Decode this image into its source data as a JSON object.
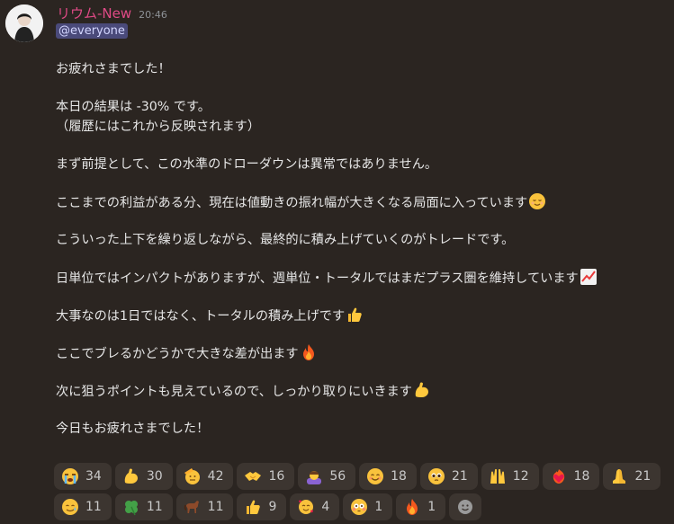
{
  "message": {
    "username": "リウム-New",
    "timestamp": "20:46",
    "mention": "@everyone",
    "lines": [
      "お疲れさまでした！",
      "本日の結果は -30% です。",
      "（履歴にはこれから反映されます）",
      "まず前提として、この水準のドローダウンは異常ではありません。",
      "ここまでの利益がある分、現在は値動きの振れ幅が大きくなる局面に入っています",
      "こういった上下を繰り返しながら、最終的に積み上げていくのがトレードです。",
      "日単位ではインパクトがありますが、週単位・トータルではまだプラス圏を維持しています",
      "大事なのは1日ではなく、トータルの積み上げです",
      "ここでブレるかどうかで大きな差が出ます",
      "次に狙うポイントも見えているので、しっかり取りにいきます",
      "今日もお疲れさまでした！"
    ],
    "line_emojis": [
      "relieved-face",
      "chart-increasing",
      "thumbs-up",
      "fire",
      "flexed-biceps"
    ]
  },
  "reactions": [
    {
      "icon": "loudly-crying-face",
      "count": "34"
    },
    {
      "icon": "flexed-biceps",
      "count": "30"
    },
    {
      "icon": "saluting-face",
      "count": "42"
    },
    {
      "icon": "handshake",
      "count": "16"
    },
    {
      "icon": "person-bowing",
      "count": "56"
    },
    {
      "icon": "smiling-face",
      "count": "18"
    },
    {
      "icon": "pleading-face",
      "count": "21"
    },
    {
      "icon": "raising-hands",
      "count": "12"
    },
    {
      "icon": "heart-on-fire",
      "count": "18"
    },
    {
      "icon": "folded-hands",
      "count": "21"
    },
    {
      "icon": "smiling-face-with-tear",
      "count": "11"
    },
    {
      "icon": "four-leaf-clover",
      "count": "11"
    },
    {
      "icon": "horse",
      "count": "11"
    },
    {
      "icon": "thumbs-up",
      "count": "9"
    },
    {
      "icon": "smiling-face-with-hearts",
      "count": "4"
    },
    {
      "icon": "flushed-face",
      "count": "1"
    },
    {
      "icon": "fire",
      "count": "1"
    }
  ],
  "add_reaction_icon": "add-reaction-icon"
}
